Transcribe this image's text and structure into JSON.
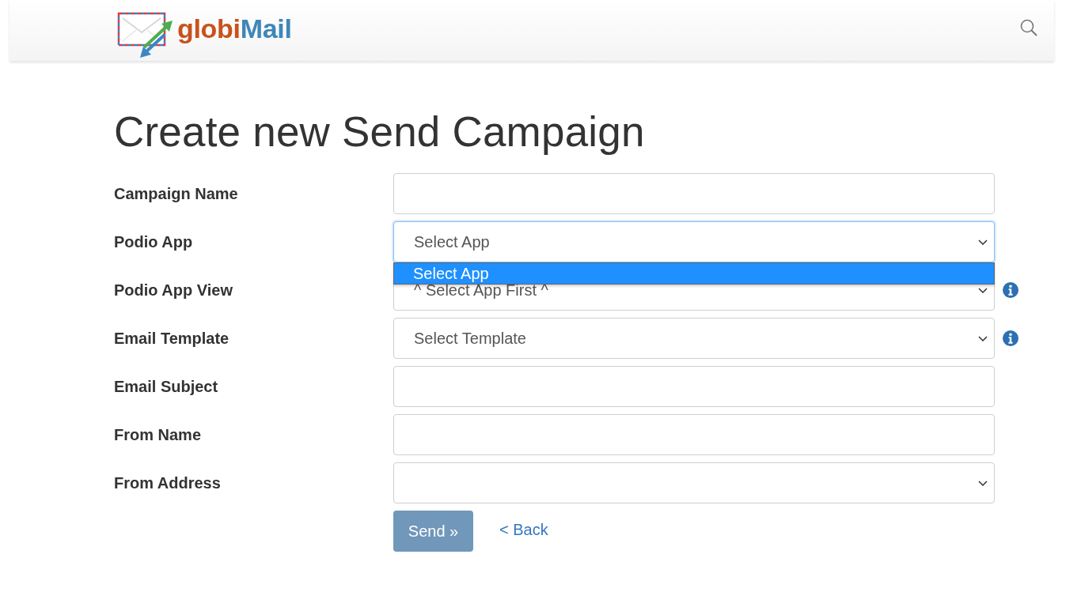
{
  "header": {
    "logo": {
      "parts": [
        "globi",
        "Mail"
      ]
    }
  },
  "title": "Create new Send Campaign",
  "fields": [
    {
      "label": "Campaign Name",
      "kind": "text",
      "focused": false,
      "info": false
    },
    {
      "label": "Podio App",
      "kind": "select",
      "value": "Select App",
      "focused": true,
      "info": false,
      "options": [
        {
          "label": "Select App",
          "selected": true
        }
      ]
    },
    {
      "label": "Podio App View",
      "kind": "select",
      "value": "^ Select App First ^",
      "focused": false,
      "info": true
    },
    {
      "label": "Email Template",
      "kind": "select",
      "value": "Select Template",
      "focused": false,
      "info": true
    },
    {
      "label": "Email Subject",
      "kind": "text",
      "focused": false,
      "info": false
    },
    {
      "label": "From Name",
      "kind": "text",
      "focused": false,
      "info": false
    },
    {
      "label": "From Address",
      "kind": "select",
      "focused": false,
      "info": false
    }
  ],
  "actions": {
    "send": "Send »",
    "back": "< Back"
  }
}
